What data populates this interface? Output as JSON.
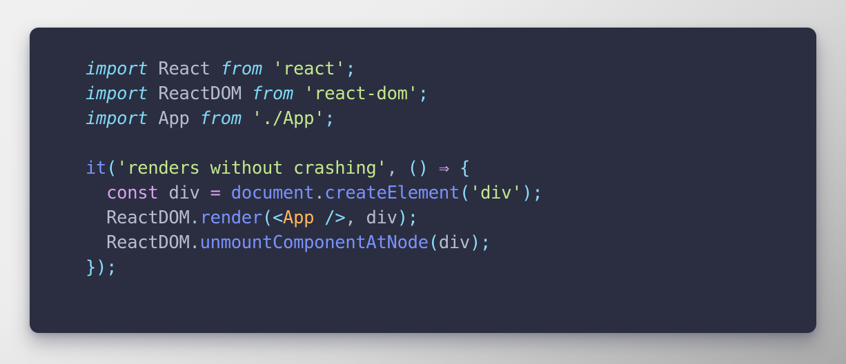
{
  "editor": {
    "background_color": "#2b2e40",
    "page_background": "#e9e9e9",
    "language": "javascript",
    "colors": {
      "keyword": "#7fd9f7",
      "identifier": "#b6bdd0",
      "string": "#c3e88d",
      "punctuation": "#89ddff",
      "function": "#7a92ff",
      "operator": "#d8a0f0",
      "jsx_tag": "#ffb65c"
    }
  },
  "code": {
    "lines": [
      {
        "index": 1,
        "text": "import React from 'react';",
        "tokens": [
          {
            "t": "import",
            "c": "kw"
          },
          {
            "t": " ",
            "c": "plain"
          },
          {
            "t": "React",
            "c": "ident"
          },
          {
            "t": " ",
            "c": "plain"
          },
          {
            "t": "from",
            "c": "kw"
          },
          {
            "t": " ",
            "c": "plain"
          },
          {
            "t": "'react'",
            "c": "str"
          },
          {
            "t": ";",
            "c": "punct"
          }
        ]
      },
      {
        "index": 2,
        "text": "import ReactDOM from 'react-dom';",
        "tokens": [
          {
            "t": "import",
            "c": "kw"
          },
          {
            "t": " ",
            "c": "plain"
          },
          {
            "t": "ReactDOM",
            "c": "ident"
          },
          {
            "t": " ",
            "c": "plain"
          },
          {
            "t": "from",
            "c": "kw"
          },
          {
            "t": " ",
            "c": "plain"
          },
          {
            "t": "'react-dom'",
            "c": "str"
          },
          {
            "t": ";",
            "c": "punct"
          }
        ]
      },
      {
        "index": 3,
        "text": "import App from './App';",
        "tokens": [
          {
            "t": "import",
            "c": "kw"
          },
          {
            "t": " ",
            "c": "plain"
          },
          {
            "t": "App",
            "c": "ident"
          },
          {
            "t": " ",
            "c": "plain"
          },
          {
            "t": "from",
            "c": "kw"
          },
          {
            "t": " ",
            "c": "plain"
          },
          {
            "t": "'./App'",
            "c": "str"
          },
          {
            "t": ";",
            "c": "punct"
          }
        ]
      },
      {
        "index": 4,
        "text": "",
        "tokens": []
      },
      {
        "index": 5,
        "text": "it('renders without crashing', () => {",
        "tokens": [
          {
            "t": "it",
            "c": "fn"
          },
          {
            "t": "(",
            "c": "punct"
          },
          {
            "t": "'renders without crashing'",
            "c": "str"
          },
          {
            "t": ",",
            "c": "plain"
          },
          {
            "t": " ",
            "c": "plain"
          },
          {
            "t": "()",
            "c": "punct"
          },
          {
            "t": " ",
            "c": "plain"
          },
          {
            "t": "⇒",
            "c": "arrow"
          },
          {
            "t": " ",
            "c": "plain"
          },
          {
            "t": "{",
            "c": "punct"
          }
        ]
      },
      {
        "index": 6,
        "text": "  const div = document.createElement('div');",
        "tokens": [
          {
            "t": "  ",
            "c": "plain"
          },
          {
            "t": "const",
            "c": "kw2"
          },
          {
            "t": " ",
            "c": "plain"
          },
          {
            "t": "div",
            "c": "ident"
          },
          {
            "t": " ",
            "c": "plain"
          },
          {
            "t": "=",
            "c": "op"
          },
          {
            "t": " ",
            "c": "plain"
          },
          {
            "t": "document",
            "c": "prop"
          },
          {
            "t": ".",
            "c": "plain"
          },
          {
            "t": "createElement",
            "c": "prop"
          },
          {
            "t": "(",
            "c": "punct"
          },
          {
            "t": "'div'",
            "c": "str"
          },
          {
            "t": ")",
            "c": "punct"
          },
          {
            "t": ";",
            "c": "punct"
          }
        ]
      },
      {
        "index": 7,
        "text": "  ReactDOM.render(<App />, div);",
        "tokens": [
          {
            "t": "  ",
            "c": "plain"
          },
          {
            "t": "ReactDOM",
            "c": "ident"
          },
          {
            "t": ".",
            "c": "plain"
          },
          {
            "t": "render",
            "c": "prop"
          },
          {
            "t": "(",
            "c": "punct"
          },
          {
            "t": "<",
            "c": "punct"
          },
          {
            "t": "App",
            "c": "tag"
          },
          {
            "t": " ",
            "c": "plain"
          },
          {
            "t": "/>",
            "c": "punct"
          },
          {
            "t": ",",
            "c": "plain"
          },
          {
            "t": " ",
            "c": "plain"
          },
          {
            "t": "div",
            "c": "ident"
          },
          {
            "t": ")",
            "c": "punct"
          },
          {
            "t": ";",
            "c": "punct"
          }
        ]
      },
      {
        "index": 8,
        "text": "  ReactDOM.unmountComponentAtNode(div);",
        "tokens": [
          {
            "t": "  ",
            "c": "plain"
          },
          {
            "t": "ReactDOM",
            "c": "ident"
          },
          {
            "t": ".",
            "c": "plain"
          },
          {
            "t": "unmountComponentAtNode",
            "c": "prop"
          },
          {
            "t": "(",
            "c": "punct"
          },
          {
            "t": "div",
            "c": "ident"
          },
          {
            "t": ")",
            "c": "punct"
          },
          {
            "t": ";",
            "c": "punct"
          }
        ]
      },
      {
        "index": 9,
        "text": "});",
        "tokens": [
          {
            "t": "}",
            "c": "punct"
          },
          {
            "t": ")",
            "c": "punct"
          },
          {
            "t": ";",
            "c": "punct"
          }
        ]
      }
    ]
  }
}
